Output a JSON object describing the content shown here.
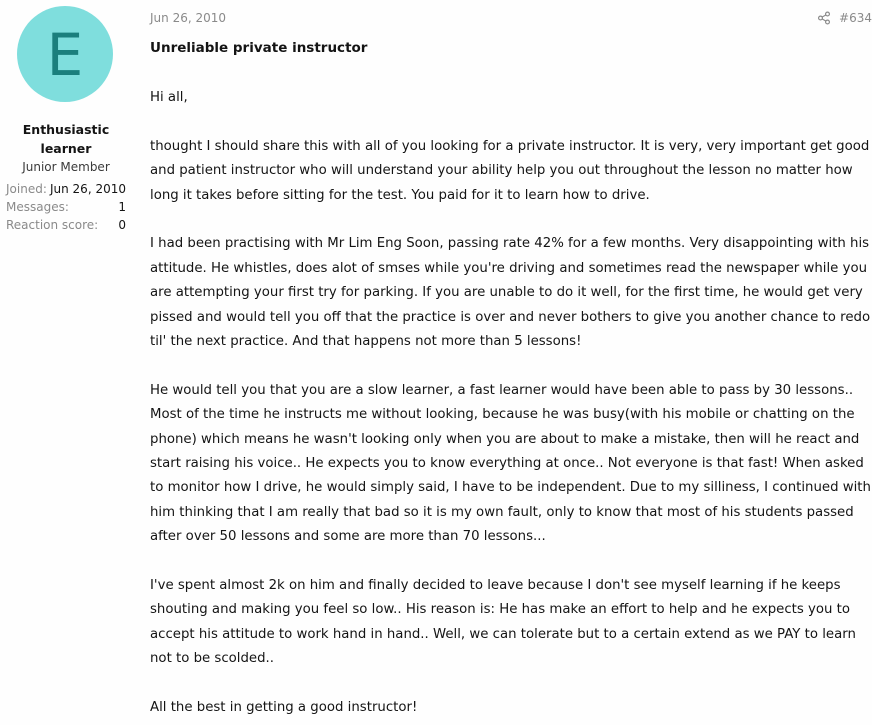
{
  "user": {
    "avatar_letter": "E",
    "name": "Enthusiastic learner",
    "title": "Junior Member",
    "stats": [
      {
        "label": "Joined:",
        "value": "Jun 26, 2010"
      },
      {
        "label": "Messages:",
        "value": "1"
      },
      {
        "label": "Reaction score:",
        "value": "0"
      }
    ]
  },
  "post": {
    "date": "Jun 26, 2010",
    "number": "#634",
    "share_icon": "share-icon",
    "title": "Unreliable private instructor",
    "paragraphs": [
      "Hi all,",
      "thought I should share this with all of you looking for a private instructor. It is very, very important get good and patient instructor who will understand your ability help you out throughout the lesson no matter how long it takes before sitting for the test. You paid for it to learn how to drive.",
      "I had been practising with Mr Lim Eng Soon, passing rate 42% for a few months. Very disappointing with his attitude. He whistles, does alot of smses while you're driving and sometimes read the newspaper while you are attempting your first try for parking. If you are unable to do it well, for the first time, he would get very pissed and would tell you off that the practice is over and never bothers to give you another chance to redo til' the next practice. And that happens not more than 5 lessons!",
      "He would tell you that you are a slow learner, a fast learner would have been able to pass by 30 lessons.. Most of the time he instructs me without looking, because he was busy(with his mobile or chatting on the phone) which means he wasn't looking only when you are about to make a mistake, then will he react and start raising his voice.. He expects you to know everything at once.. Not everyone is that fast! When asked to monitor how I drive, he would simply said, I have to be independent. Due to my silliness, I continued with him thinking that I am really that bad so it is my own fault, only to know that most of his students passed after over 50 lessons and some are more than 70 lessons...",
      "I've spent almost 2k on him and finally decided to leave because I don't see myself learning if he keeps shouting and making you feel so low.. His reason is: He has make an effort to help and he expects you to accept his attitude to work hand in hand.. Well, we can tolerate but to a certain extend as we PAY to learn not to be scolded..",
      "All the best in getting a good instructor!"
    ]
  },
  "colors": {
    "avatar_bg": "#7fdedd",
    "avatar_fg": "#1b7f7d",
    "muted_text": "#8a8a8a",
    "body_text": "#141414"
  }
}
